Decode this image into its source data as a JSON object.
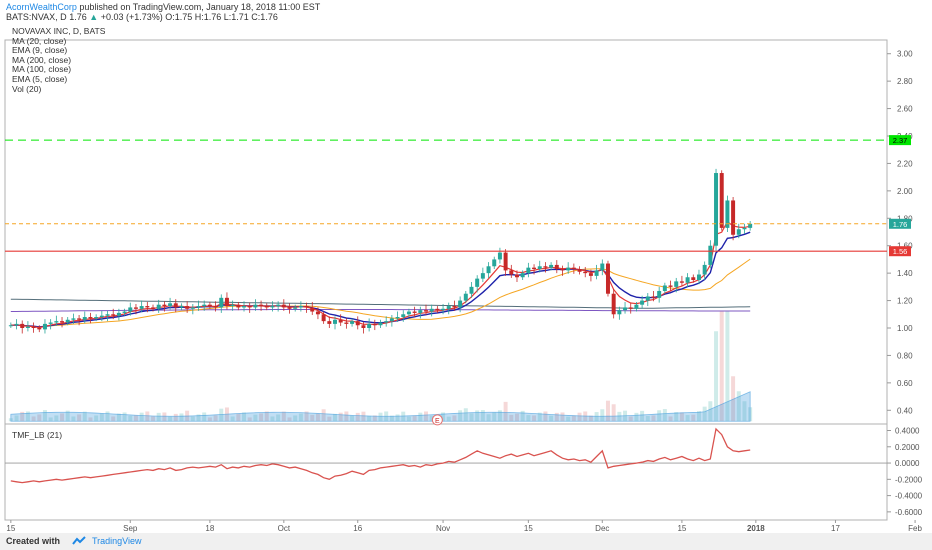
{
  "header": {
    "author": "AcornWealthCorp",
    "published_text": "published on TradingView.com, January 18, 2018 11:00 EST",
    "symbol": "BATS:NVAX, D",
    "last": "1.76",
    "change": "+0.03 (+1.73%)",
    "ohlc": "O:1.75 H:1.76 L:1.71 C:1.76",
    "up_color": "#26a69a"
  },
  "legend": {
    "title": "NOVAVAX INC, D, BATS",
    "items": [
      "MA (20, close)",
      "EMA (9, close)",
      "MA (200, close)",
      "MA (100, close)",
      "EMA (5, close)",
      "Vol (20)"
    ]
  },
  "tmf_label": "TMF_LB (21)",
  "footer": {
    "created": "Created with",
    "brand": "TradingView"
  },
  "colors": {
    "up": "#26a69a",
    "down": "#c62828",
    "ema9": "#1e22aa",
    "ma20": "#f5a623",
    "ma100": "#7e57c2",
    "ma200": "#546e7a",
    "ema5": "#e53935",
    "resistance": "#00e600",
    "support": "#e53935",
    "last_line": "#f5a623",
    "tmf": "#d9534f",
    "volume": "#4fa3e0"
  },
  "chart_data": {
    "type": "candlestick",
    "price_ylim": [
      0.3,
      3.1
    ],
    "price_ticks": [
      "3.00",
      "2.80",
      "2.60",
      "2.40",
      "2.20",
      "2.00",
      "1.80",
      "1.60",
      "1.40",
      "1.20",
      "1.00",
      "0.80",
      "0.60",
      "0.40"
    ],
    "tmf_ylim": [
      -0.7,
      0.48
    ],
    "tmf_ticks": [
      "0.4000",
      "0.2000",
      "0.0000",
      "-0.2000",
      "-0.4000",
      "-0.6000"
    ],
    "x_labels": [
      "15",
      "Sep",
      "18",
      "Oct",
      "16",
      "Nov",
      "15",
      "Dec",
      "15",
      "2018",
      "17",
      "Feb"
    ],
    "horizontal_levels": [
      {
        "value": 2.37,
        "label": "2.37",
        "kind": "resistance"
      },
      {
        "value": 1.56,
        "label": "1.56",
        "kind": "support"
      },
      {
        "value": 1.76,
        "label": "1.76",
        "kind": "last"
      }
    ],
    "earnings_marker": "E",
    "candles_close": [
      1.02,
      1.03,
      1.0,
      1.01,
      1.0,
      0.99,
      1.03,
      1.04,
      1.05,
      1.04,
      1.06,
      1.07,
      1.06,
      1.08,
      1.07,
      1.08,
      1.09,
      1.1,
      1.09,
      1.11,
      1.12,
      1.15,
      1.14,
      1.16,
      1.15,
      1.14,
      1.17,
      1.16,
      1.18,
      1.15,
      1.16,
      1.14,
      1.15,
      1.16,
      1.17,
      1.16,
      1.15,
      1.22,
      1.16,
      1.17,
      1.15,
      1.16,
      1.15,
      1.17,
      1.16,
      1.15,
      1.16,
      1.17,
      1.15,
      1.14,
      1.15,
      1.16,
      1.15,
      1.12,
      1.1,
      1.05,
      1.03,
      1.06,
      1.04,
      1.03,
      1.05,
      1.02,
      1.0,
      1.03,
      1.02,
      1.04,
      1.05,
      1.07,
      1.08,
      1.1,
      1.12,
      1.11,
      1.13,
      1.12,
      1.14,
      1.13,
      1.14,
      1.16,
      1.15,
      1.2,
      1.25,
      1.3,
      1.36,
      1.4,
      1.45,
      1.5,
      1.55,
      1.42,
      1.39,
      1.37,
      1.4,
      1.44,
      1.43,
      1.45,
      1.44,
      1.46,
      1.43,
      1.42,
      1.44,
      1.43,
      1.41,
      1.4,
      1.38,
      1.42,
      1.47,
      1.25,
      1.1,
      1.13,
      1.15,
      1.14,
      1.17,
      1.2,
      1.23,
      1.22,
      1.27,
      1.31,
      1.3,
      1.34,
      1.33,
      1.37,
      1.35,
      1.39,
      1.46,
      1.6,
      2.13,
      1.73,
      1.93,
      1.68,
      1.72,
      1.73,
      1.76
    ],
    "series": [
      {
        "name": "TMF_LB (21)",
        "values": [
          -0.22,
          -0.23,
          -0.24,
          -0.23,
          -0.22,
          -0.23,
          -0.22,
          -0.21,
          -0.2,
          -0.21,
          -0.2,
          -0.19,
          -0.18,
          -0.17,
          -0.18,
          -0.17,
          -0.16,
          -0.15,
          -0.14,
          -0.13,
          -0.12,
          -0.11,
          -0.1,
          -0.09,
          -0.08,
          -0.09,
          -0.07,
          -0.08,
          -0.06,
          -0.09,
          -0.08,
          -0.06,
          -0.05,
          -0.06,
          -0.05,
          -0.04,
          -0.05,
          -0.02,
          -0.07,
          -0.05,
          -0.06,
          -0.04,
          -0.05,
          -0.03,
          -0.02,
          -0.03,
          -0.01,
          -0.02,
          -0.04,
          -0.06,
          -0.05,
          -0.07,
          -0.09,
          -0.12,
          -0.14,
          -0.18,
          -0.2,
          -0.16,
          -0.15,
          -0.13,
          -0.1,
          -0.12,
          -0.14,
          -0.09,
          -0.08,
          -0.06,
          -0.05,
          -0.04,
          -0.03,
          -0.02,
          -0.04,
          -0.03,
          -0.05,
          -0.02,
          -0.03,
          -0.01,
          0.0,
          0.02,
          0.01,
          0.04,
          0.07,
          0.11,
          0.15,
          0.12,
          0.1,
          0.08,
          0.06,
          0.09,
          0.11,
          0.08,
          0.1,
          0.12,
          0.09,
          0.11,
          0.13,
          0.15,
          0.1,
          0.06,
          0.04,
          0.05,
          0.03,
          0.04,
          0.01,
          0.08,
          0.15,
          -0.06,
          -0.04,
          -0.03,
          -0.02,
          -0.01,
          0.0,
          0.01,
          0.03,
          0.02,
          0.05,
          0.07,
          0.04,
          0.06,
          0.08,
          0.05,
          0.03,
          0.06,
          0.03,
          0.05,
          0.42,
          0.35,
          0.2,
          0.15,
          0.14,
          0.15,
          0.16
        ]
      }
    ],
    "volume_ma_description": "Vol (20)"
  }
}
